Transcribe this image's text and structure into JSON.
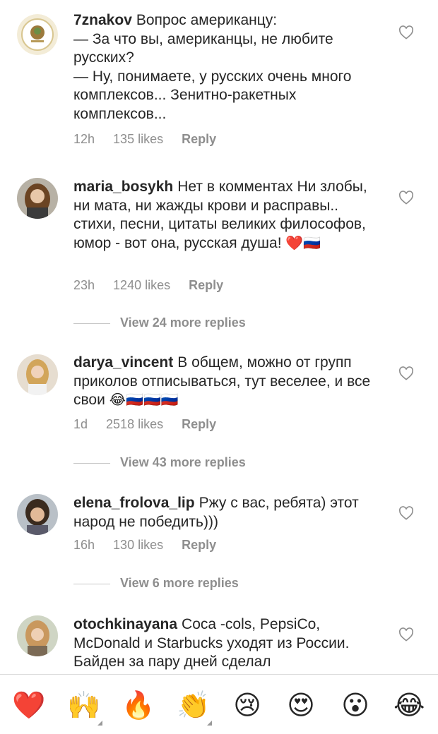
{
  "comments": [
    {
      "username": "7znakov",
      "text": "Вопрос американцу:\n— За что вы, американцы, не любите русских?\n— Ну, понимаете, у русских очень много комплексов... Зенитно-ракетных комплексов...",
      "time": "12h",
      "likes": "135 likes",
      "reply": "Reply",
      "avatar": "logo-avatar"
    },
    {
      "username": "maria_bosykh",
      "text": "Нет в комментах Ни злобы, ни мата, ни жажды крови и расправы.. стихи, песни, цитаты великих философов, юмор - вот она, русская душа!",
      "emoji": "❤️🇷🇺",
      "time": "23h",
      "likes": "1240 likes",
      "reply": "Reply",
      "view_replies": "View 24 more replies",
      "avatar": "photo-avatar"
    },
    {
      "username": "darya_vincent",
      "text": "В общем, можно от групп приколов отписываться, тут веселее, и все свои",
      "emoji": "😂🇷🇺🇷🇺🇷🇺",
      "time": "1d",
      "likes": "2518 likes",
      "reply": "Reply",
      "view_replies": "View 43 more replies",
      "avatar": "photo-avatar"
    },
    {
      "username": "elena_frolova_lip",
      "text": "Ржу с вас, ребята) этот народ не победить)))",
      "time": "16h",
      "likes": "130 likes",
      "reply": "Reply",
      "view_replies": "View 6 more replies",
      "avatar": "photo-avatar"
    },
    {
      "username": "otochkinayana",
      "text": "Coca -cols, PepsiCo, McDonald и Starbucks  уходят из России. Байден за пару дней сделал",
      "avatar": "photo-avatar"
    }
  ],
  "reactions": [
    {
      "emoji": "❤️",
      "icon": "red-heart"
    },
    {
      "emoji": "🙌",
      "icon": "raising-hands"
    },
    {
      "emoji": "🔥",
      "icon": "fire"
    },
    {
      "emoji": "👏",
      "icon": "clapping-hands"
    },
    {
      "emoji": "😢",
      "icon": "crying-face"
    },
    {
      "emoji": "😍",
      "icon": "heart-eyes"
    },
    {
      "emoji": "😮",
      "icon": "surprised-face"
    },
    {
      "emoji": "😂",
      "icon": "tears-of-joy"
    }
  ],
  "colors": {
    "primary_text": "#262626",
    "secondary_text": "#8e8e8e",
    "divider": "#dbdbdb"
  }
}
